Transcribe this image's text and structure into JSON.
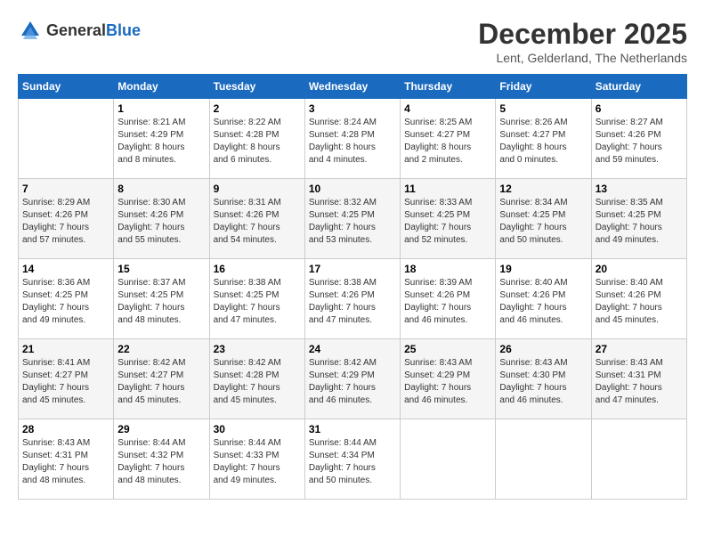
{
  "logo": {
    "general": "General",
    "blue": "Blue"
  },
  "header": {
    "month": "December 2025",
    "location": "Lent, Gelderland, The Netherlands"
  },
  "days_of_week": [
    "Sunday",
    "Monday",
    "Tuesday",
    "Wednesday",
    "Thursday",
    "Friday",
    "Saturday"
  ],
  "weeks": [
    [
      {
        "day": "",
        "info": ""
      },
      {
        "day": "1",
        "info": "Sunrise: 8:21 AM\nSunset: 4:29 PM\nDaylight: 8 hours\nand 8 minutes."
      },
      {
        "day": "2",
        "info": "Sunrise: 8:22 AM\nSunset: 4:28 PM\nDaylight: 8 hours\nand 6 minutes."
      },
      {
        "day": "3",
        "info": "Sunrise: 8:24 AM\nSunset: 4:28 PM\nDaylight: 8 hours\nand 4 minutes."
      },
      {
        "day": "4",
        "info": "Sunrise: 8:25 AM\nSunset: 4:27 PM\nDaylight: 8 hours\nand 2 minutes."
      },
      {
        "day": "5",
        "info": "Sunrise: 8:26 AM\nSunset: 4:27 PM\nDaylight: 8 hours\nand 0 minutes."
      },
      {
        "day": "6",
        "info": "Sunrise: 8:27 AM\nSunset: 4:26 PM\nDaylight: 7 hours\nand 59 minutes."
      }
    ],
    [
      {
        "day": "7",
        "info": "Sunrise: 8:29 AM\nSunset: 4:26 PM\nDaylight: 7 hours\nand 57 minutes."
      },
      {
        "day": "8",
        "info": "Sunrise: 8:30 AM\nSunset: 4:26 PM\nDaylight: 7 hours\nand 55 minutes."
      },
      {
        "day": "9",
        "info": "Sunrise: 8:31 AM\nSunset: 4:26 PM\nDaylight: 7 hours\nand 54 minutes."
      },
      {
        "day": "10",
        "info": "Sunrise: 8:32 AM\nSunset: 4:25 PM\nDaylight: 7 hours\nand 53 minutes."
      },
      {
        "day": "11",
        "info": "Sunrise: 8:33 AM\nSunset: 4:25 PM\nDaylight: 7 hours\nand 52 minutes."
      },
      {
        "day": "12",
        "info": "Sunrise: 8:34 AM\nSunset: 4:25 PM\nDaylight: 7 hours\nand 50 minutes."
      },
      {
        "day": "13",
        "info": "Sunrise: 8:35 AM\nSunset: 4:25 PM\nDaylight: 7 hours\nand 49 minutes."
      }
    ],
    [
      {
        "day": "14",
        "info": "Sunrise: 8:36 AM\nSunset: 4:25 PM\nDaylight: 7 hours\nand 49 minutes."
      },
      {
        "day": "15",
        "info": "Sunrise: 8:37 AM\nSunset: 4:25 PM\nDaylight: 7 hours\nand 48 minutes."
      },
      {
        "day": "16",
        "info": "Sunrise: 8:38 AM\nSunset: 4:25 PM\nDaylight: 7 hours\nand 47 minutes."
      },
      {
        "day": "17",
        "info": "Sunrise: 8:38 AM\nSunset: 4:26 PM\nDaylight: 7 hours\nand 47 minutes."
      },
      {
        "day": "18",
        "info": "Sunrise: 8:39 AM\nSunset: 4:26 PM\nDaylight: 7 hours\nand 46 minutes."
      },
      {
        "day": "19",
        "info": "Sunrise: 8:40 AM\nSunset: 4:26 PM\nDaylight: 7 hours\nand 46 minutes."
      },
      {
        "day": "20",
        "info": "Sunrise: 8:40 AM\nSunset: 4:26 PM\nDaylight: 7 hours\nand 45 minutes."
      }
    ],
    [
      {
        "day": "21",
        "info": "Sunrise: 8:41 AM\nSunset: 4:27 PM\nDaylight: 7 hours\nand 45 minutes."
      },
      {
        "day": "22",
        "info": "Sunrise: 8:42 AM\nSunset: 4:27 PM\nDaylight: 7 hours\nand 45 minutes."
      },
      {
        "day": "23",
        "info": "Sunrise: 8:42 AM\nSunset: 4:28 PM\nDaylight: 7 hours\nand 45 minutes."
      },
      {
        "day": "24",
        "info": "Sunrise: 8:42 AM\nSunset: 4:29 PM\nDaylight: 7 hours\nand 46 minutes."
      },
      {
        "day": "25",
        "info": "Sunrise: 8:43 AM\nSunset: 4:29 PM\nDaylight: 7 hours\nand 46 minutes."
      },
      {
        "day": "26",
        "info": "Sunrise: 8:43 AM\nSunset: 4:30 PM\nDaylight: 7 hours\nand 46 minutes."
      },
      {
        "day": "27",
        "info": "Sunrise: 8:43 AM\nSunset: 4:31 PM\nDaylight: 7 hours\nand 47 minutes."
      }
    ],
    [
      {
        "day": "28",
        "info": "Sunrise: 8:43 AM\nSunset: 4:31 PM\nDaylight: 7 hours\nand 48 minutes."
      },
      {
        "day": "29",
        "info": "Sunrise: 8:44 AM\nSunset: 4:32 PM\nDaylight: 7 hours\nand 48 minutes."
      },
      {
        "day": "30",
        "info": "Sunrise: 8:44 AM\nSunset: 4:33 PM\nDaylight: 7 hours\nand 49 minutes."
      },
      {
        "day": "31",
        "info": "Sunrise: 8:44 AM\nSunset: 4:34 PM\nDaylight: 7 hours\nand 50 minutes."
      },
      {
        "day": "",
        "info": ""
      },
      {
        "day": "",
        "info": ""
      },
      {
        "day": "",
        "info": ""
      }
    ]
  ]
}
